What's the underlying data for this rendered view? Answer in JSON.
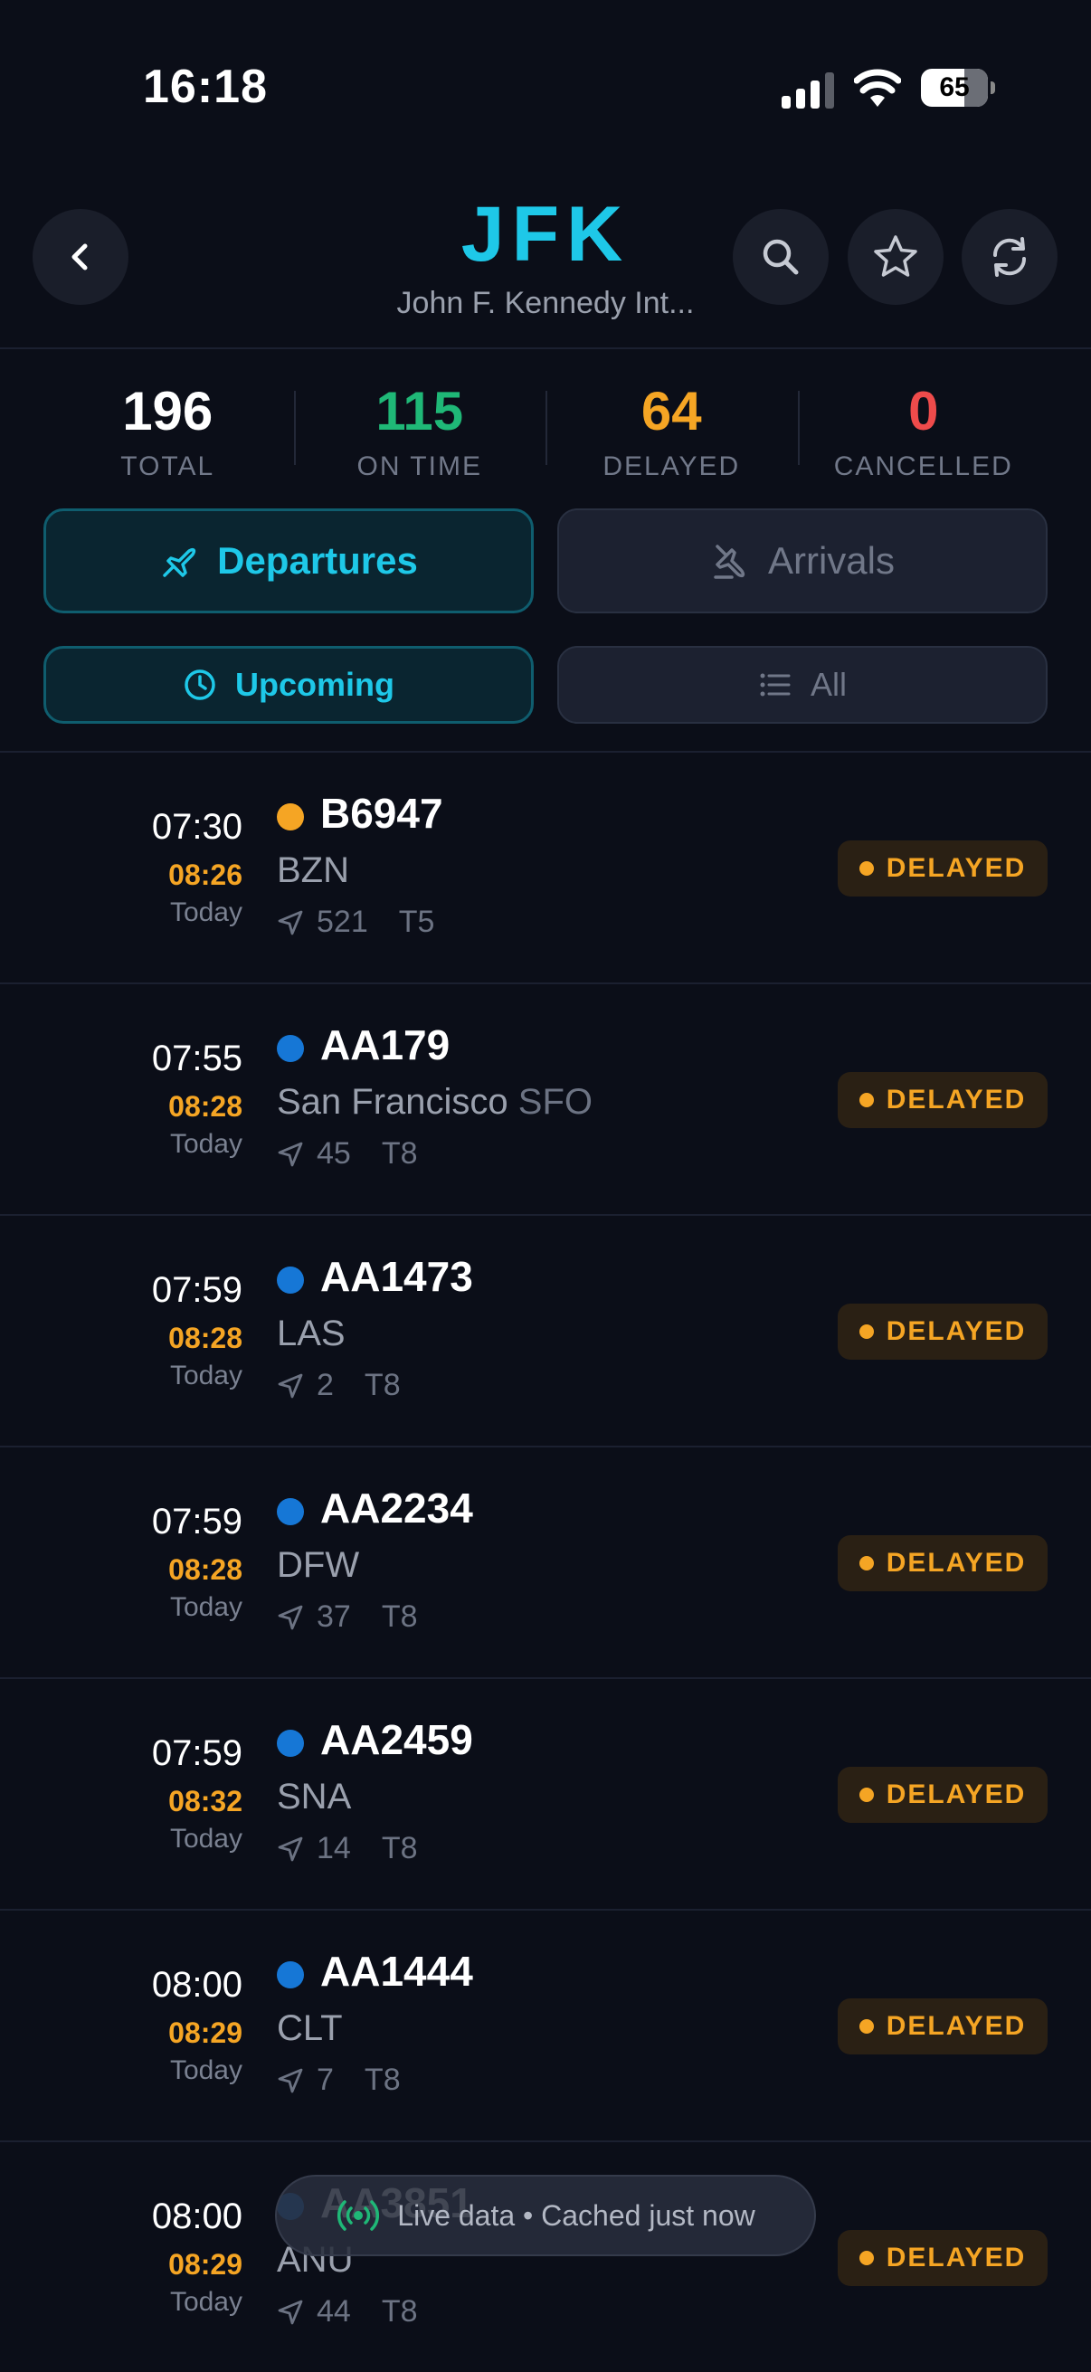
{
  "status_bar": {
    "time": "16:18",
    "battery": "65"
  },
  "header": {
    "code": "JFK",
    "name": "John F. Kennedy Int..."
  },
  "stats": [
    {
      "value": "196",
      "label": "TOTAL",
      "color": "#ffffff"
    },
    {
      "value": "115",
      "label": "ON TIME",
      "color": "#1fb877"
    },
    {
      "value": "64",
      "label": "DELAYED",
      "color": "#f5a524"
    },
    {
      "value": "0",
      "label": "CANCELLED",
      "color": "#ef4b4b"
    }
  ],
  "tabs": {
    "departures": "Departures",
    "arrivals": "Arrivals"
  },
  "filters": {
    "upcoming": "Upcoming",
    "all": "All"
  },
  "flights": [
    {
      "sched": "07:30",
      "est": "08:26",
      "day": "Today",
      "flight": "B6947",
      "dest": "BZN",
      "dest_code": "",
      "gate": "521",
      "terminal": "T5",
      "status": "DELAYED",
      "dot_color": "#f5a524"
    },
    {
      "sched": "07:55",
      "est": "08:28",
      "day": "Today",
      "flight": "AA179",
      "dest": "San Francisco",
      "dest_code": "SFO",
      "gate": "45",
      "terminal": "T8",
      "status": "DELAYED",
      "dot_color": "#1677d6"
    },
    {
      "sched": "07:59",
      "est": "08:28",
      "day": "Today",
      "flight": "AA1473",
      "dest": "LAS",
      "dest_code": "",
      "gate": "2",
      "terminal": "T8",
      "status": "DELAYED",
      "dot_color": "#1677d6"
    },
    {
      "sched": "07:59",
      "est": "08:28",
      "day": "Today",
      "flight": "AA2234",
      "dest": "DFW",
      "dest_code": "",
      "gate": "37",
      "terminal": "T8",
      "status": "DELAYED",
      "dot_color": "#1677d6"
    },
    {
      "sched": "07:59",
      "est": "08:32",
      "day": "Today",
      "flight": "AA2459",
      "dest": "SNA",
      "dest_code": "",
      "gate": "14",
      "terminal": "T8",
      "status": "DELAYED",
      "dot_color": "#1677d6"
    },
    {
      "sched": "08:00",
      "est": "08:29",
      "day": "Today",
      "flight": "AA1444",
      "dest": "CLT",
      "dest_code": "",
      "gate": "7",
      "terminal": "T8",
      "status": "DELAYED",
      "dot_color": "#1677d6"
    },
    {
      "sched": "08:00",
      "est": "08:29",
      "day": "Today",
      "flight": "AA3851",
      "dest": "ANU",
      "dest_code": "",
      "gate": "44",
      "terminal": "T8",
      "status": "DELAYED",
      "dot_color": "#1677d6"
    }
  ],
  "toast": {
    "text": "Live data • Cached just now"
  }
}
